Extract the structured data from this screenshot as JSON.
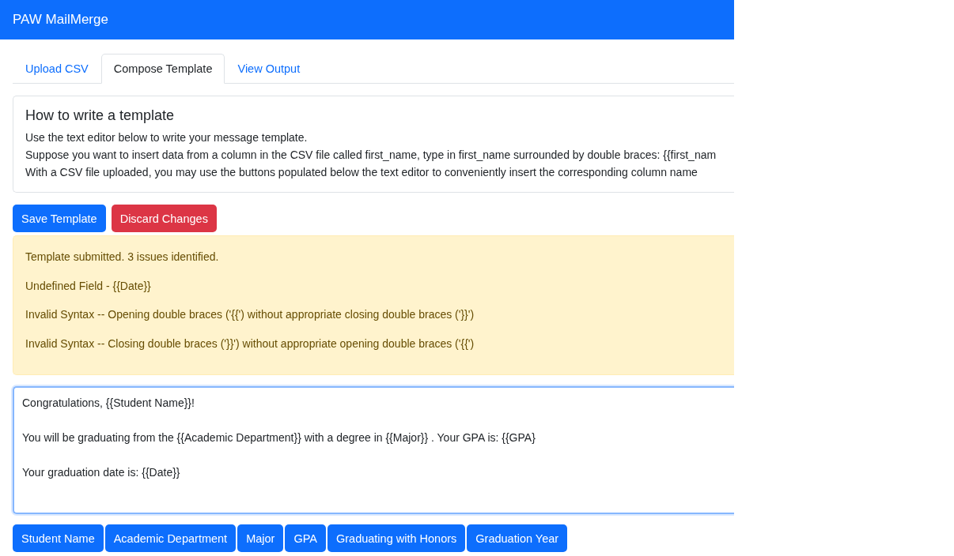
{
  "app_bar": {
    "title": "PAW MailMerge"
  },
  "tabs": [
    {
      "label": "Upload CSV",
      "selected": false
    },
    {
      "label": "Compose Template",
      "selected": true
    },
    {
      "label": "View Output",
      "selected": false
    }
  ],
  "instructions": {
    "title": "How to write a template",
    "lines": [
      "Use the text editor below to write your message template.",
      "Suppose you want to insert data from a column in the CSV file called first_name, type in first_name surrounded by double braces: {{first_nam",
      "With a CSV file uploaded, you may use the buttons populated below the text editor to conveniently insert the corresponding column name"
    ]
  },
  "actions": [
    {
      "label": "Save Template",
      "kind": "primary"
    },
    {
      "label": "Discard Changes",
      "kind": "danger"
    }
  ],
  "alert": {
    "messages": [
      "Template submitted. 3 issues identified.",
      "Undefined Field - {{Date}}",
      "Invalid Syntax -- Opening double braces ('{{') without appropriate closing double braces ('}}')",
      "Invalid Syntax -- Closing double braces ('}}') without appropriate opening double braces ('{{')"
    ]
  },
  "editor": {
    "paragraphs": [
      "Congratulations, {{Student Name}}!",
      "You will be graduating from the {{Academic Department}} with a degree in {{Major}} . Your GPA is: {{GPA}",
      "Your graduation date is: {{Date}}"
    ]
  },
  "field_buttons": [
    "Student Name",
    "Academic Department",
    "Major",
    "GPA",
    "Graduating with Honors",
    "Graduation Year"
  ]
}
